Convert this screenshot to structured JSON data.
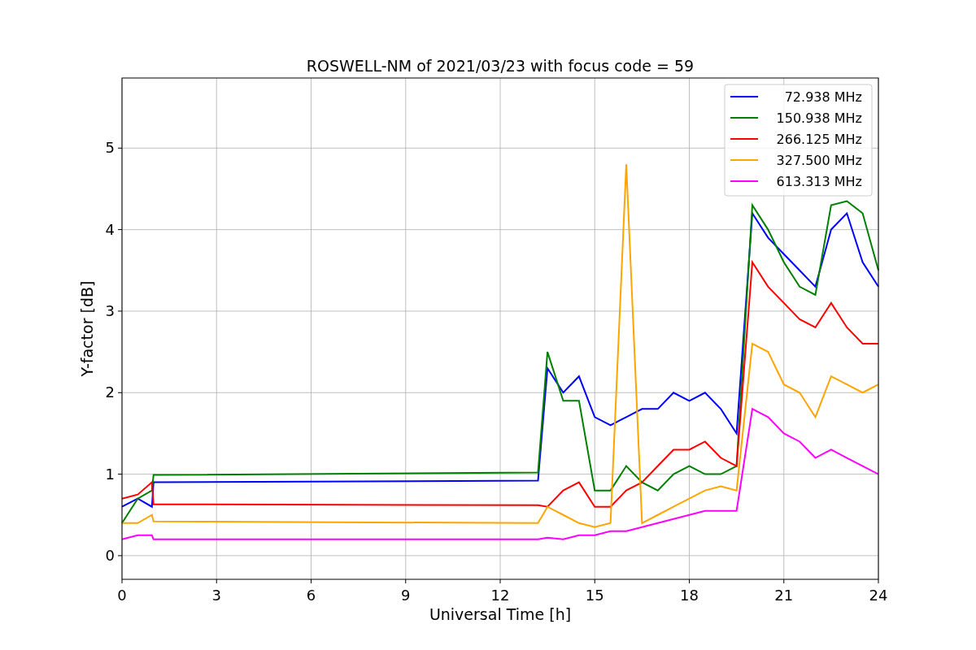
{
  "figure": {
    "chart_data": {
      "type": "line",
      "title": "ROSWELL-NM of 2021/03/23 with focus code = 59",
      "xlabel": "Universal Time [h]",
      "ylabel": "Y-factor [dB]",
      "x": [
        0,
        0.5,
        0.95,
        1,
        13.2,
        13.5,
        14,
        14.5,
        15,
        15.5,
        16,
        16.5,
        17,
        17.5,
        18,
        18.5,
        19,
        19.5,
        20,
        20.5,
        21,
        21.5,
        22,
        22.5,
        23,
        23.5,
        24
      ],
      "series": [
        {
          "name": "72.938 MHz",
          "color": "#0000ff",
          "values": [
            0.6,
            0.7,
            0.6,
            0.9,
            0.92,
            2.3,
            2.0,
            2.2,
            1.7,
            1.6,
            1.7,
            1.8,
            1.8,
            2.0,
            1.9,
            2.0,
            1.8,
            1.5,
            4.2,
            3.9,
            3.7,
            3.5,
            3.3,
            4.0,
            4.2,
            3.6,
            3.3
          ]
        },
        {
          "name": "150.938 MHz",
          "color": "#008000",
          "values": [
            0.4,
            0.7,
            0.8,
            0.99,
            1.02,
            2.5,
            1.9,
            1.9,
            0.8,
            0.8,
            1.1,
            0.9,
            0.8,
            1.0,
            1.1,
            1.0,
            1.0,
            1.1,
            4.3,
            4.0,
            3.6,
            3.3,
            3.2,
            4.3,
            4.35,
            4.2,
            3.5
          ]
        },
        {
          "name": "266.125 MHz",
          "color": "#ff0000",
          "values": [
            0.7,
            0.75,
            0.9,
            0.63,
            0.62,
            0.6,
            0.8,
            0.9,
            0.6,
            0.6,
            0.8,
            0.9,
            1.1,
            1.3,
            1.3,
            1.4,
            1.2,
            1.1,
            3.6,
            3.3,
            3.1,
            2.9,
            2.8,
            3.1,
            2.8,
            2.6,
            2.6
          ]
        },
        {
          "name": "327.500 MHz",
          "color": "#ffa500",
          "values": [
            0.4,
            0.4,
            0.5,
            0.42,
            0.4,
            0.6,
            0.5,
            0.4,
            0.35,
            0.4,
            4.8,
            0.4,
            0.5,
            0.6,
            0.7,
            0.8,
            0.85,
            0.8,
            2.6,
            2.5,
            2.1,
            2.0,
            1.7,
            2.2,
            2.1,
            2.0,
            2.1
          ]
        },
        {
          "name": "613.313 MHz",
          "color": "#ff00ff",
          "values": [
            0.2,
            0.25,
            0.25,
            0.2,
            0.2,
            0.22,
            0.2,
            0.25,
            0.25,
            0.3,
            0.3,
            0.35,
            0.4,
            0.45,
            0.5,
            0.55,
            0.55,
            0.55,
            1.8,
            1.7,
            1.5,
            1.4,
            1.2,
            1.3,
            1.2,
            1.1,
            1.0
          ]
        }
      ],
      "xlim": [
        0,
        24
      ],
      "ylim": [
        -0.29,
        5.86
      ],
      "xticks": [
        0,
        3,
        6,
        9,
        12,
        15,
        18,
        21,
        24
      ],
      "yticks": [
        0,
        1,
        2,
        3,
        4,
        5
      ],
      "grid": true,
      "legend": true
    }
  }
}
